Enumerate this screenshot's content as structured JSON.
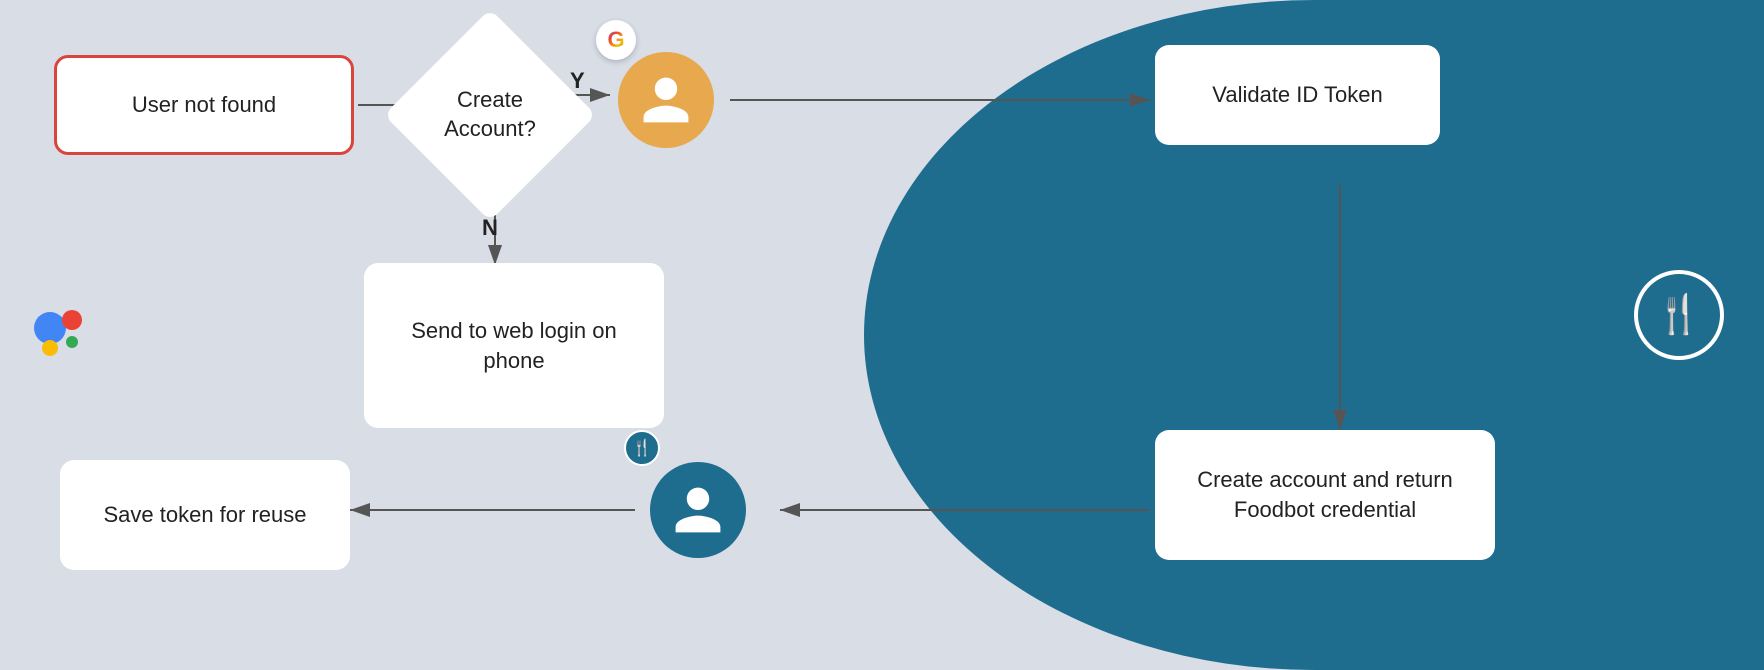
{
  "nodes": {
    "user_not_found": "User not found",
    "create_account": "Create\nAccount?",
    "send_to_web": "Send to web login\non phone",
    "validate_id": "Validate ID\nToken",
    "create_account_return": "Create account and\nreturn Foodbot\ncredential",
    "save_token": "Save token\nfor reuse"
  },
  "labels": {
    "yes": "Y",
    "no": "N"
  },
  "colors": {
    "bg_left": "#d8dde6",
    "bg_right": "#1e6d8e",
    "box_border_red": "#d9453d",
    "arrow_color": "#555555",
    "user_icon_orange": "#e8a84e",
    "user_icon_blue": "#1e6d8e",
    "white": "#ffffff"
  }
}
